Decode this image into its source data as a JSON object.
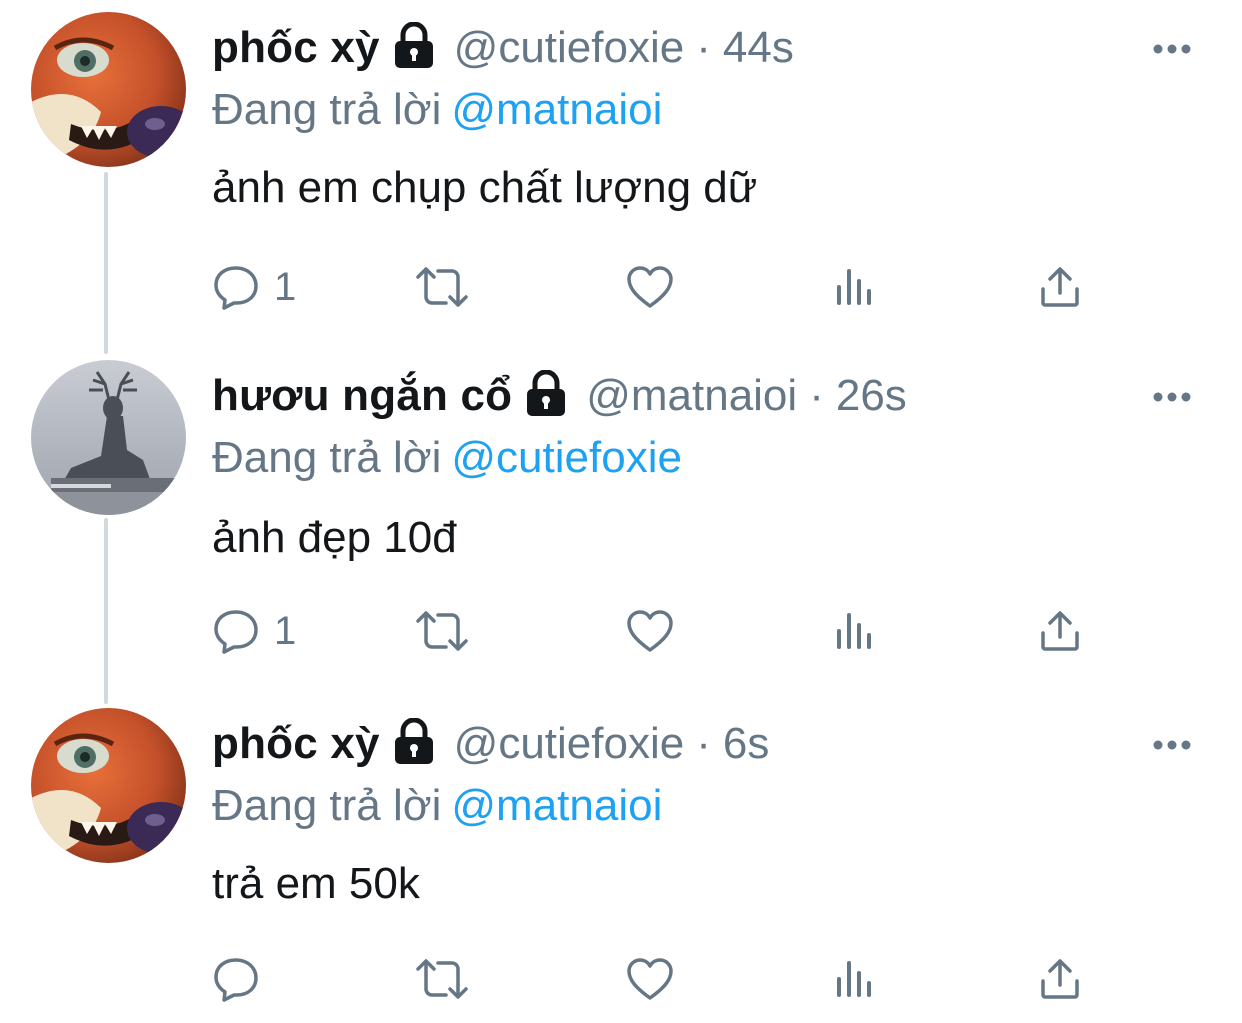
{
  "tweets": [
    {
      "name": "phốc xỳ",
      "handle": "@cutiefoxie",
      "separator": "·",
      "time": "44s",
      "reply_prefix": "Đang trả lời",
      "reply_to": "@matnaioi",
      "text": "ảnh em chụp chất lượng dữ",
      "reply_count": "1",
      "avatar": "fox-avatar"
    },
    {
      "name": "hươu ngắn cổ",
      "handle": "@matnaioi",
      "separator": "·",
      "time": "26s",
      "reply_prefix": "Đang trả lời",
      "reply_to": "@cutiefoxie",
      "text": "ảnh đẹp 10đ",
      "reply_count": "1",
      "avatar": "deer-avatar"
    },
    {
      "name": "phốc xỳ",
      "handle": "@cutiefoxie",
      "separator": "·",
      "time": "6s",
      "reply_prefix": "Đang trả lời",
      "reply_to": "@matnaioi",
      "text": "trả em 50k",
      "reply_count": "",
      "avatar": "fox-avatar"
    }
  ],
  "icons": {
    "lock": "lock-icon",
    "more": "more-icon",
    "reply": "reply-icon",
    "retweet": "retweet-icon",
    "like": "heart-icon",
    "analytics": "analytics-icon",
    "share": "share-icon"
  },
  "colors": {
    "text": "#14171a",
    "secondary": "#657786",
    "link": "#1da1f2",
    "thread_line": "#cfd9de"
  }
}
